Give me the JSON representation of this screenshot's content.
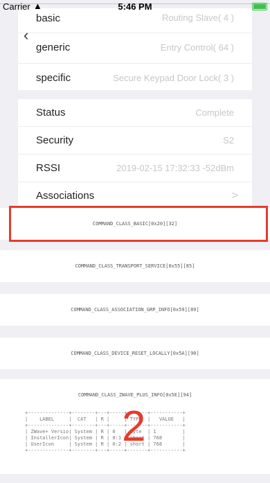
{
  "status_bar": {
    "carrier": "Carrier",
    "time": "5:46 PM"
  },
  "device_info": {
    "rows": [
      {
        "label": "basic",
        "value": "Routing Slave( 4 )"
      },
      {
        "label": "generic",
        "value": "Entry Control( 64 )"
      },
      {
        "label": "specific",
        "value": "Secure Keypad Door Lock( 3 )"
      }
    ]
  },
  "device_status": {
    "rows": [
      {
        "label": "Status",
        "value": "Complete"
      },
      {
        "label": "Security",
        "value": "S2"
      },
      {
        "label": "RSSI",
        "value": "2019-02-15 17:32:33 -52dBm"
      },
      {
        "label": "Associations",
        "value": ">"
      }
    ]
  },
  "command_classes": [
    "COMMAND_CLASS_BASIC[0x20][32]",
    "COMMAND_CLASS_TRANSPORT_SERVICE[0x55][85]",
    "COMMAND_CLASS_ASSOCIATION_GRP_INFO[0x59][89]",
    "COMMAND_CLASS_DEVICE_RESET_LOCALLY[0x5A][90]",
    "COMMAND_CLASS_ZWAVE_PLUS_INFO[0x5E][94]"
  ],
  "zwave_plus_table": {
    "headers": [
      "LABEL",
      "CAT",
      "R",
      "",
      "TYPE",
      "VALUE"
    ],
    "rows": [
      [
        "ZWave+ Version",
        "System",
        "R",
        "0",
        "byte",
        "1"
      ],
      [
        "InstallerIcon",
        "System",
        "R",
        "0:1",
        "short",
        "768"
      ],
      [
        "UserIcon",
        "System",
        "R",
        "0:2",
        "short",
        "768"
      ]
    ]
  },
  "overlay_number": "2",
  "colors": {
    "highlight": "#e83a2a",
    "background": "#efeff4"
  }
}
